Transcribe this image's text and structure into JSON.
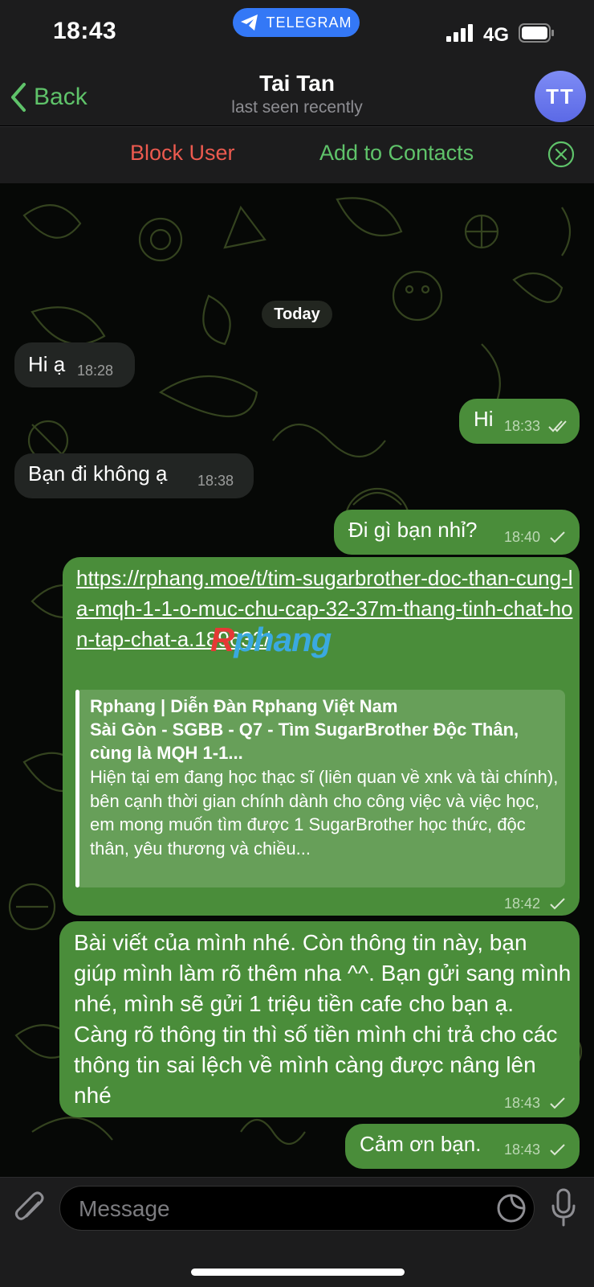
{
  "status_bar": {
    "time": "18:43",
    "app_badge": "TELEGRAM",
    "network": "4G",
    "icons": [
      "signal-bars-icon",
      "battery-icon"
    ]
  },
  "header": {
    "back_label": "Back",
    "title": "Tai Tan",
    "subtitle": "last seen recently",
    "avatar_initials": "TT"
  },
  "action_bar": {
    "block_label": "Block User",
    "add_label": "Add to Contacts",
    "close_icon": "close-circle-icon"
  },
  "chat": {
    "date_label": "Today",
    "watermark": {
      "part1": "R",
      "part2": "phang"
    },
    "messages": [
      {
        "direction": "in",
        "text": "Hi ạ",
        "time": "18:28"
      },
      {
        "direction": "out",
        "text": "Hi",
        "time": "18:33",
        "status": "read"
      },
      {
        "direction": "in",
        "text": "Bạn đi không ạ",
        "time": "18:38"
      },
      {
        "direction": "out",
        "text": "Đi gì bạn nhỉ?",
        "time": "18:40",
        "status": "sent"
      },
      {
        "direction": "out",
        "link": "https://rphang.moe/t/tim-sugarbrother-doc-than-cung-la-mqh-1-1-o-muc-chu-cap-32-37m-thang-tinh-chat-hon-tap-chat-a.189632/",
        "preview": {
          "site": "Rphang | Diễn Đàn Rphang Việt Nam",
          "title": "Sài Gòn - SGBB - Q7 - Tìm SugarBrother Độc Thân, cùng là MQH 1-1...",
          "description": "Hiện tại em đang học thạc sĩ (liên quan về xnk và tài chính), bên cạnh thời gian chính dành cho công việc và việc học, em mong muốn tìm được 1 SugarBrother học thức, độc thân, yêu thương và chiều..."
        },
        "time": "18:42",
        "status": "sent"
      },
      {
        "direction": "out",
        "text": "Bài viết của mình nhé. Còn thông tin này, bạn giúp mình làm rõ thêm nha ^^. Bạn gửi sang mình nhé, mình sẽ gửi 1 triệu tiền cafe cho bạn ạ. Càng rõ thông tin thì số tiền mình chi trả cho các thông tin sai lệch về mình càng được nâng lên nhé",
        "time": "18:43",
        "status": "sent"
      },
      {
        "direction": "out",
        "text": "Cảm ơn bạn.",
        "time": "18:43",
        "status": "sent"
      }
    ]
  },
  "input_bar": {
    "placeholder": "Message",
    "icons": [
      "paperclip-icon",
      "sticker-icon",
      "microphone-icon"
    ]
  },
  "colors": {
    "accent_green": "#5fc36a",
    "block_red": "#ec5a4f",
    "outgoing_bubble": "#4a8d3a",
    "incoming_bubble": "#222523",
    "telegram_blue": "#3478f6"
  }
}
